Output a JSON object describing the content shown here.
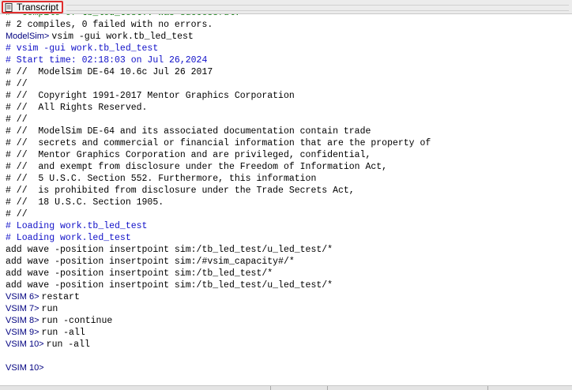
{
  "window": {
    "tab_title": "Transcript",
    "icon": "transcript-icon"
  },
  "transcript": {
    "lines": [
      {
        "kind": "cut",
        "text": "#  Compile of tb_led_test.v was successful."
      },
      {
        "kind": "output",
        "text": "# 2 compiles, 0 failed with no errors."
      },
      {
        "kind": "prompt",
        "prompt": "ModelSim> ",
        "text": "vsim -gui work.tb_led_test"
      },
      {
        "kind": "comment",
        "text": "# vsim -gui work.tb_led_test"
      },
      {
        "kind": "comment",
        "text": "# Start time: 02:18:03 on Jul 26,2024"
      },
      {
        "kind": "output",
        "text": "# //  ModelSim DE-64 10.6c Jul 26 2017"
      },
      {
        "kind": "output",
        "text": "# //"
      },
      {
        "kind": "output",
        "text": "# //  Copyright 1991-2017 Mentor Graphics Corporation"
      },
      {
        "kind": "output",
        "text": "# //  All Rights Reserved."
      },
      {
        "kind": "output",
        "text": "# //"
      },
      {
        "kind": "output",
        "text": "# //  ModelSim DE-64 and its associated documentation contain trade"
      },
      {
        "kind": "output",
        "text": "# //  secrets and commercial or financial information that are the property of"
      },
      {
        "kind": "output",
        "text": "# //  Mentor Graphics Corporation and are privileged, confidential,"
      },
      {
        "kind": "output",
        "text": "# //  and exempt from disclosure under the Freedom of Information Act,"
      },
      {
        "kind": "output",
        "text": "# //  5 U.S.C. Section 552. Furthermore, this information"
      },
      {
        "kind": "output",
        "text": "# //  is prohibited from disclosure under the Trade Secrets Act,"
      },
      {
        "kind": "output",
        "text": "# //  18 U.S.C. Section 1905."
      },
      {
        "kind": "output",
        "text": "# //"
      },
      {
        "kind": "comment",
        "text": "# Loading work.tb_led_test"
      },
      {
        "kind": "comment",
        "text": "# Loading work.led_test"
      },
      {
        "kind": "output",
        "text": "add wave -position insertpoint sim:/tb_led_test/u_led_test/*"
      },
      {
        "kind": "output",
        "text": "add wave -position insertpoint sim:/#vsim_capacity#/*"
      },
      {
        "kind": "output",
        "text": "add wave -position insertpoint sim:/tb_led_test/*"
      },
      {
        "kind": "output",
        "text": "add wave -position insertpoint sim:/tb_led_test/u_led_test/*"
      },
      {
        "kind": "prompt",
        "prompt": "VSIM 6> ",
        "text": "restart"
      },
      {
        "kind": "prompt",
        "prompt": "VSIM 7> ",
        "text": "run"
      },
      {
        "kind": "prompt",
        "prompt": "VSIM 8> ",
        "text": "run -continue"
      },
      {
        "kind": "prompt",
        "prompt": "VSIM 9> ",
        "text": "run -all"
      },
      {
        "kind": "prompt",
        "prompt": "VSIM 10> ",
        "text": "run -all"
      },
      {
        "kind": "blank",
        "text": ""
      },
      {
        "kind": "prompt",
        "prompt": "VSIM 10> ",
        "text": ""
      }
    ]
  },
  "colors": {
    "comment": "#1010c8",
    "prompt": "#000080",
    "highlight_border": "#e02d2d"
  }
}
